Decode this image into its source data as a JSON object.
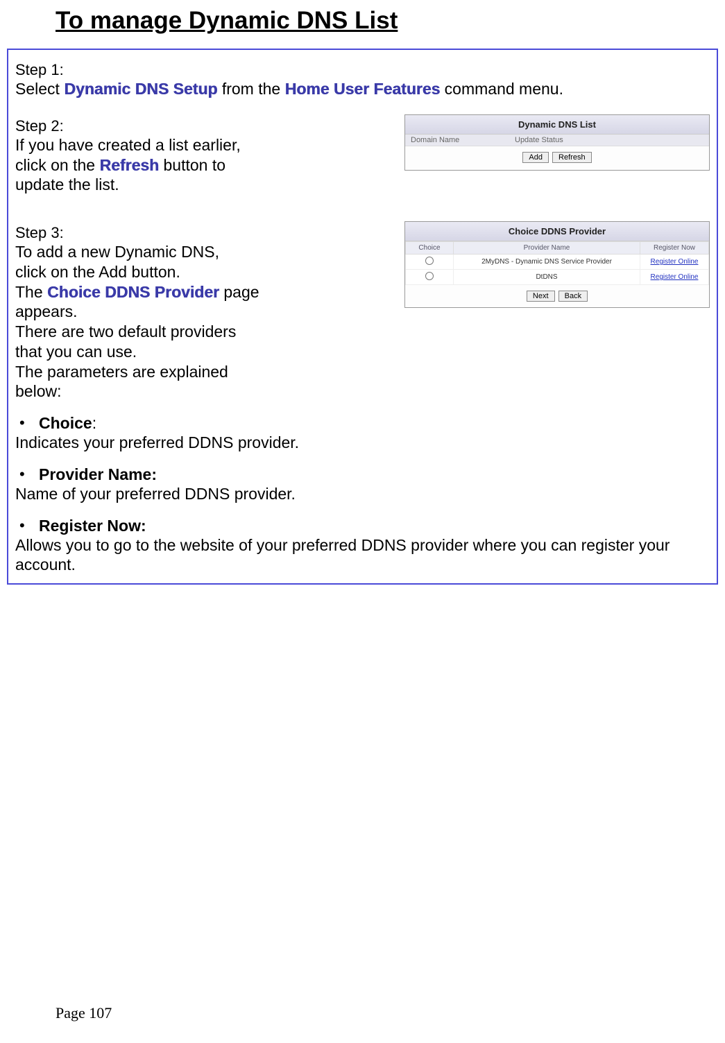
{
  "title": "To manage Dynamic DNS List",
  "step1": {
    "label": "Step 1:",
    "pre": "Select ",
    "hl1": "Dynamic DNS Setup",
    "mid": " from the ",
    "hl2": "Home User Features",
    "post": " command menu."
  },
  "step2": {
    "label": "Step 2:",
    "line1": "If you have created a list earlier,",
    "line2a": "click on the ",
    "line2hl": "Refresh",
    "line2b": " button to",
    "line3": "update the list.",
    "panel": {
      "title": "Dynamic DNS List",
      "col1": "Domain Name",
      "col2": "Update Status",
      "btn_add": "Add",
      "btn_refresh": "Refresh"
    }
  },
  "step3": {
    "label": "Step 3:",
    "line1": "To add a new Dynamic DNS,",
    "line2": "click on the Add button.",
    "line3a": "The ",
    "line3hl": "Choice DDNS Provider",
    "line3b": " page",
    "line4": "appears.",
    "line5": "There are two default providers",
    "line6": "that you can use.",
    "line7": "The parameters are explained",
    "line8": "below:",
    "panel": {
      "title": "Choice DDNS Provider",
      "headers": [
        "Choice",
        "Provider Name",
        "Register Now"
      ],
      "rows": [
        {
          "provider": "2MyDNS - Dynamic DNS Service Provider",
          "link": "Register Online"
        },
        {
          "provider": "DtDNS",
          "link": "Register Online"
        }
      ],
      "btn_next": "Next",
      "btn_back": "Back"
    }
  },
  "bullets": [
    {
      "label": "Choice",
      "suffix": ":",
      "desc": "Indicates your preferred DDNS provider."
    },
    {
      "label": "Provider Name:",
      "suffix": "",
      "desc": "Name of your preferred DDNS provider."
    },
    {
      "label": "Register Now:",
      "suffix": "",
      "desc": "Allows you to go to the website of your preferred DDNS provider where you can register your account."
    }
  ],
  "footer": "Page 107"
}
